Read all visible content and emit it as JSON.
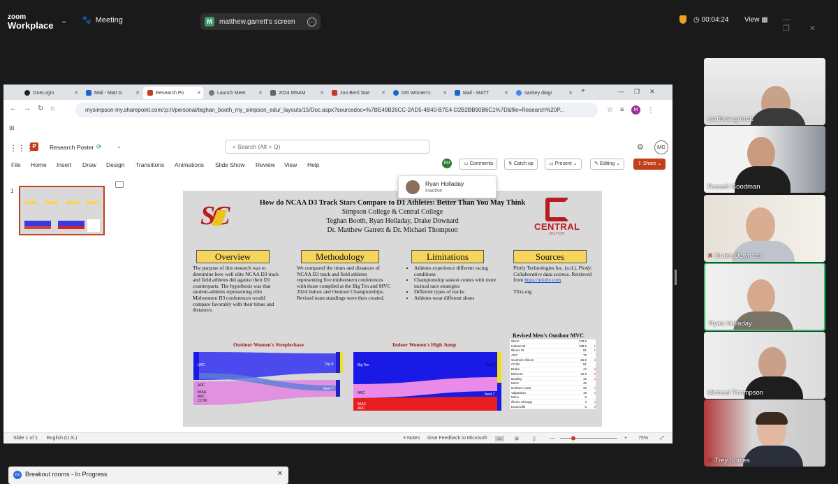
{
  "zoom": {
    "logo_line1": "zoom",
    "logo_line2": "Workplace",
    "meeting_label": "Meeting",
    "share_chip_letter": "M",
    "share_chip_label": "matthew.garrett's screen",
    "timer": "00:04:24",
    "view_label": "View",
    "accent": "#36c06b"
  },
  "browser": {
    "tabs": [
      {
        "label": "OneLogin",
        "color": "#222222"
      },
      {
        "label": "Mail - Matt G",
        "color": "#1a66c9"
      },
      {
        "label": "Research Po",
        "color": "#c43e1c"
      },
      {
        "label": "Launch Meet",
        "color": "#555555"
      },
      {
        "label": "2024 MSAM",
        "color": "#555555"
      },
      {
        "label": "Jon Berti Stat",
        "color": "#c0392b"
      },
      {
        "label": "DIII Women's",
        "color": "#1a66c9"
      },
      {
        "label": "Mail - MATT",
        "color": "#1a66c9"
      },
      {
        "label": "sankey diagr",
        "color": "#4285f4"
      }
    ],
    "url": "mysimpson-my.sharepoint.com/:p:/r/personal/teghan_booth_my_simpson_edu/_layouts/15/Doc.aspx?sourcedoc=%7BE49B26CC-2AD5-4B40-B7E4-D2B2BB90B6C1%7D&file=Research%20P...",
    "profile_initial": "M"
  },
  "ppt": {
    "doc_title": "Research Poster",
    "search_placeholder": "Search (Alt + Q)",
    "user_initials": "MG",
    "menu": [
      "File",
      "Home",
      "Insert",
      "Draw",
      "Design",
      "Transitions",
      "Animations",
      "Slide Show",
      "Review",
      "View",
      "Help"
    ],
    "rh_initials": "RH",
    "comments_label": "Comments",
    "catchup_label": "Catch up",
    "present_label": "Present",
    "editing_label": "Editing",
    "share_label": "Share",
    "slide_number": "1",
    "presence_name": "Ryan Holladay",
    "presence_status": "Inactive",
    "status_left": "Slide 1 of 1",
    "status_lang": "English (U.S.)",
    "status_notes": "Notes",
    "status_feedback": "Give Feedback to Microsoft",
    "zoom_level": "75%"
  },
  "poster": {
    "title": "How do NCAA D3 Track Stars Compare to D1 Athletes: Better Than You May Think",
    "line1": "Simpson College & Central College",
    "line2": "Teghan Booth, Ryan Holladay, Drake Downard",
    "line3": "Dr. Matthew Garrett & Dr. Michael Thompson",
    "central_name": "CENTRAL",
    "central_sub": "DUTCH",
    "overview_head": "Overview",
    "overview_text": "The purpose of this research was to determine how well elite NCAA D3 track and field athletes did against their D1 counterparts. The hypothesis was that student-athletes representing elite Midwestern D3 conferences would compare favorably with their times and distances.",
    "method_head": "Methodology",
    "method_text": "We compared the times and distances of NCAA D3 track and field athletes representing five midwestern conferences with those compiled at the Big Ten and MVC 2024 Indoor and Outdoor Championships. Revised team standings were then created.",
    "limits_head": "Limitations",
    "limits": [
      "Athletes experience different racing conditions",
      "Championship season comes with more tactical race strategies",
      "Different types of tracks",
      "Athletes wear different shoes"
    ],
    "sources_head": "Sources",
    "source_a": "Plotly Technologies Inc. (n.d.).",
    "source_b": "Plotly: Collaborative data science.",
    "source_c": "Retrieved from",
    "source_link": "https://plotly.com",
    "source_d": "Tfrrs.org",
    "chart1_title": "Outdoor Women's Steeplechase",
    "chart1_labels": [
      "UAC",
      "ARC",
      "MIAA",
      "ARC",
      "CCIW",
      "Top 8",
      "Next 7"
    ],
    "chart2_title": "Indoor Women's High Jump",
    "chart2_labels": [
      "Big Ten",
      "ARC",
      "MIAC",
      "ARC",
      "Top 8",
      "Next 7"
    ],
    "mvc_title": "Revised Men's Outdoor MVC",
    "mvc_rows": [
      {
        "team": "WIAC",
        "pts": "178.5",
        "rank": ""
      },
      {
        "team": "Indiana St.",
        "pts": "138.5",
        "rank": "1"
      },
      {
        "team": "Illinois St.",
        "pts": "81",
        "rank": "1"
      },
      {
        "team": "ARC",
        "pts": "70",
        "rank": ""
      },
      {
        "team": "Southern Illinois",
        "pts": "66.5",
        "rank": "2"
      },
      {
        "team": "CCIW",
        "pts": "51",
        "rank": ""
      },
      {
        "team": "Drake",
        "pts": "44",
        "rank": "2"
      },
      {
        "team": "Belmont",
        "pts": "42.5",
        "rank": "2"
      },
      {
        "team": "Bradley",
        "pts": "42",
        "rank": "2"
      },
      {
        "team": "MIAC",
        "pts": "42",
        "rank": ""
      },
      {
        "team": "Northern Iowa",
        "pts": "32",
        "rank": "7"
      },
      {
        "team": "Valparaiso",
        "pts": "18",
        "rank": "4"
      },
      {
        "team": "MIAA",
        "pts": "6",
        "rank": ""
      },
      {
        "team": "Illinois Chicago",
        "pts": "4",
        "rank": "4"
      },
      {
        "team": "Evansville",
        "pts": "0",
        "rank": "6"
      }
    ]
  },
  "participants": [
    {
      "name": "matthew.garrett",
      "muted": false
    },
    {
      "name": "Russell Goodman",
      "muted": false
    },
    {
      "name": "Drake Downard",
      "muted": true
    },
    {
      "name": "Ryan Holladay",
      "muted": false
    },
    {
      "name": "Michael Thompson",
      "muted": false
    },
    {
      "name": "Trey Sholes",
      "muted": true
    }
  ],
  "breakout": {
    "label": "Breakout rooms - In Progress",
    "icon_text": "zm"
  }
}
